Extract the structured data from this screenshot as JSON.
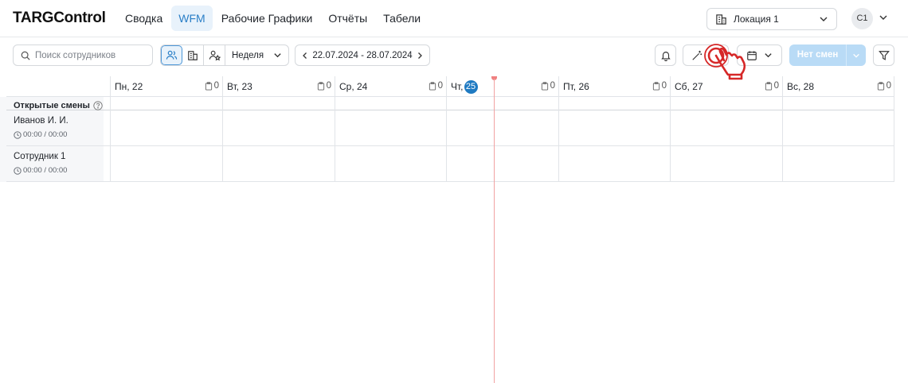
{
  "app": {
    "logo": "TARGControl"
  },
  "nav": [
    {
      "label": "Сводка",
      "active": false
    },
    {
      "label": "WFM",
      "active": true
    },
    {
      "label": "Рабочие Графики",
      "active": false
    },
    {
      "label": "Отчёты",
      "active": false
    },
    {
      "label": "Табели",
      "active": false
    }
  ],
  "location": {
    "label": "Локация 1"
  },
  "user": {
    "initials": "С1"
  },
  "toolbar": {
    "search_placeholder": "Поиск сотрудников",
    "view_modes": [
      "users-icon",
      "building-icon",
      "user-star-icon"
    ],
    "period": "Неделя",
    "date_range": "22.07.2024 - 28.07.2024",
    "publish_label": "Нет смен"
  },
  "days": [
    {
      "label": "Пн, 22",
      "count": "0",
      "today": false
    },
    {
      "label": "Вт, 23",
      "count": "0",
      "today": false
    },
    {
      "label": "Ср, 24",
      "count": "0",
      "today": false
    },
    {
      "prefix": "Чт,",
      "num": "25",
      "count": "0",
      "today": true
    },
    {
      "label": "Пт, 26",
      "count": "0",
      "today": false
    },
    {
      "label": "Сб, 27",
      "count": "0",
      "today": false
    },
    {
      "label": "Вс, 28",
      "count": "0",
      "today": false
    }
  ],
  "open_shifts": {
    "label": "Открытые смены"
  },
  "employees": [
    {
      "name": "Иванов И. И.",
      "hours": "00:00 / 00:00"
    },
    {
      "name": "Сотрудник 1",
      "hours": "00:00 / 00:00"
    }
  ],
  "colors": {
    "accent": "#1f7ac2",
    "now_line": "#f2a2a2",
    "hand": "#d62828"
  }
}
